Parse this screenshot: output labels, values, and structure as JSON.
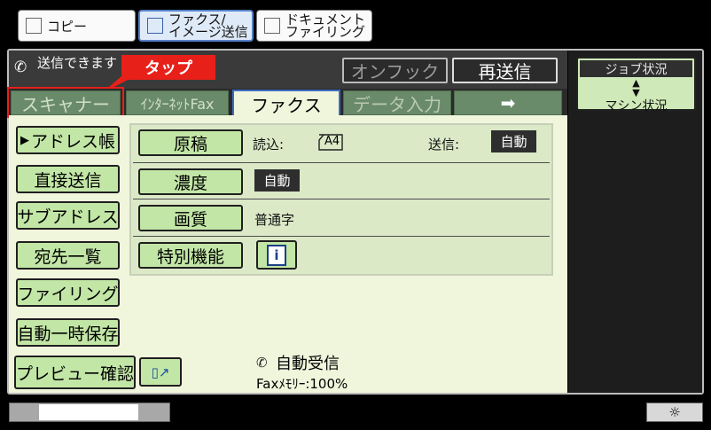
{
  "mode_tabs": [
    {
      "label": "コピー"
    },
    {
      "label_line1": "ファクス/",
      "label_line2": "イメージ送信"
    },
    {
      "label_line1": "ドキュメント",
      "label_line2": "ファイリング"
    }
  ],
  "header": {
    "status": "送信できます",
    "callout": "タップ",
    "onhook": "オンフック",
    "resend": "再送信"
  },
  "right_panel": {
    "job_status": "ジョブ状況",
    "machine_status": "マシン状況"
  },
  "tabs": [
    "スキャナー",
    "ｲﾝﾀｰﾈｯﾄFax",
    "ファクス",
    "データ入力",
    "➡"
  ],
  "left_buttons": [
    "アドレス帳",
    "直接送信",
    "サブアドレス",
    "宛先一覧",
    "ファイリング",
    "自動一時保存",
    "プレビュー確認"
  ],
  "settings": {
    "original": {
      "label": "原稿",
      "read_label": "読込:",
      "read_value": "A4",
      "send_label": "送信:",
      "send_value": "自動"
    },
    "density": {
      "label": "濃度",
      "value": "自動"
    },
    "quality": {
      "label": "画質",
      "value": "普通字"
    },
    "special": {
      "label": "特別機能"
    }
  },
  "footer": {
    "auto_receive": "自動受信",
    "fax_memory": "Faxﾒﾓﾘｰ:100%"
  },
  "colors": {
    "panel_bg": "#f0f6dc",
    "button_green": "#c2e6a6",
    "callout_red": "#e8201a",
    "tab_active_border": "#3d6cc2"
  },
  "icons": [
    "copy-icon",
    "fax-icon",
    "document-filing-icon",
    "phone-handset-icon",
    "updown-arrows-icon",
    "info-icon",
    "preview-icon",
    "auto-receive-icon",
    "brightness-icon"
  ]
}
